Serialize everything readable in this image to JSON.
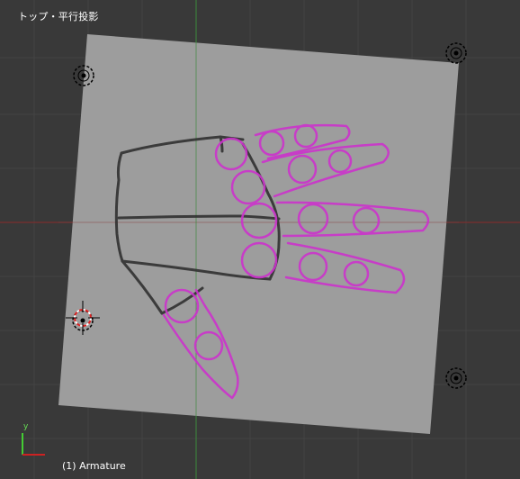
{
  "viewport": {
    "view_name": "トップ・平行投影",
    "object_info": "(1) Armature",
    "axis_y_label": "y"
  },
  "colors": {
    "background": "#393939",
    "grid_line": "#444444",
    "x_axis": "#8a2a2a",
    "y_axis": "#3a8a3a",
    "reference_plane": "#9d9d9d",
    "sketch_palm": "#2a2a2a",
    "sketch_fingers": "#cc33cc"
  },
  "icons": {
    "empty": "empty-marker-icon",
    "cursor": "3d-cursor-icon",
    "gizmo": "axis-gizmo-icon"
  }
}
